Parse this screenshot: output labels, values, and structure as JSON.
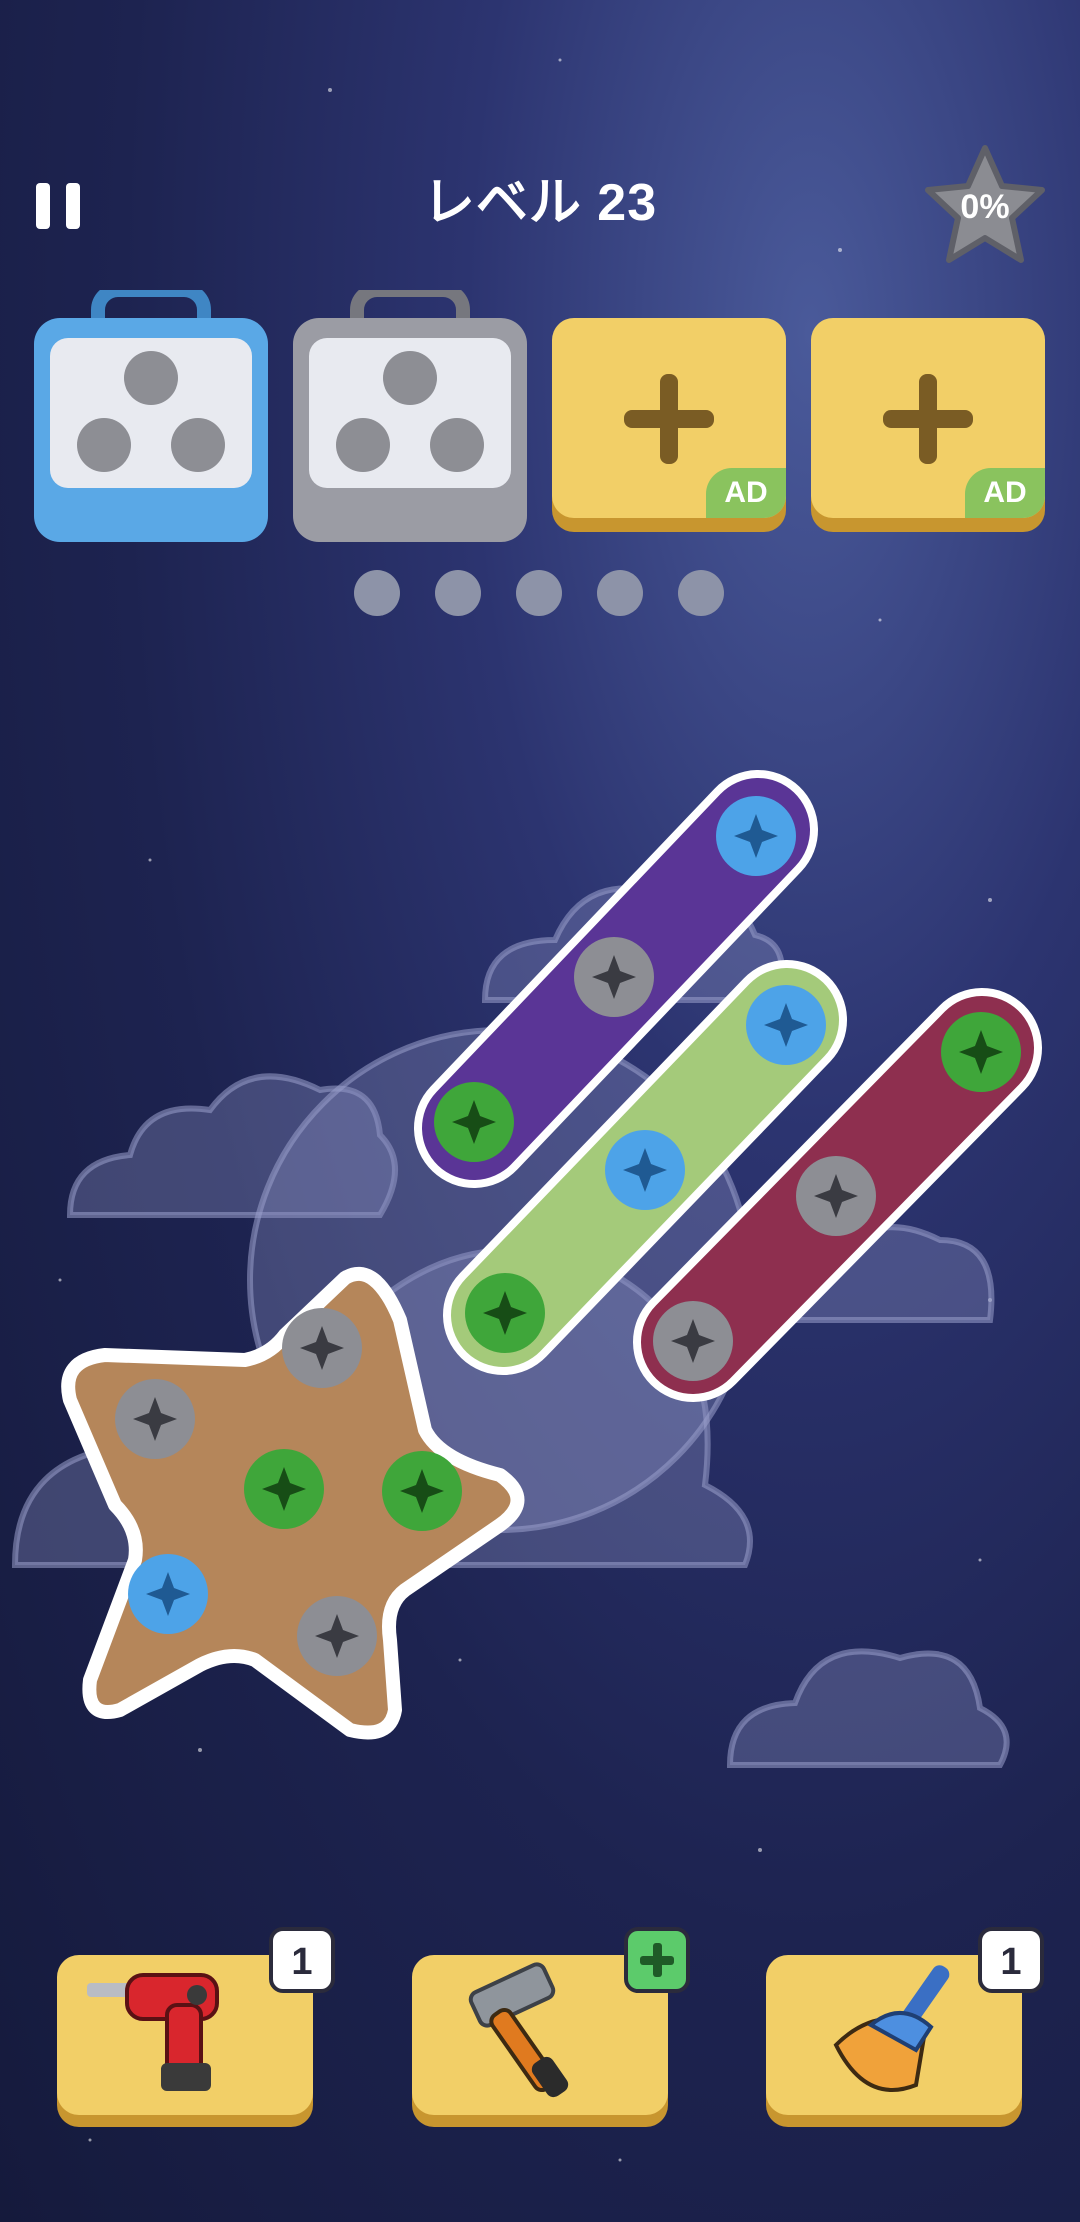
{
  "header": {
    "level_label": "レベル 23",
    "progress_label": "0%",
    "progress": 0
  },
  "boxes": [
    {
      "name": "blue-screw-box",
      "color": "#5aa8e6",
      "holes": 3
    },
    {
      "name": "gray-screw-box",
      "color": "#9b9ca4",
      "holes": 3
    }
  ],
  "ad_slots": [
    {
      "badge": "AD"
    },
    {
      "badge": "AD"
    }
  ],
  "buffer_holes": 5,
  "plates": [
    {
      "shape": "bar",
      "color": "purple",
      "screws": [
        "blue",
        "gray",
        "green"
      ]
    },
    {
      "shape": "bar",
      "color": "light-green",
      "screws": [
        "blue",
        "blue",
        "green"
      ]
    },
    {
      "shape": "bar",
      "color": "crimson",
      "screws": [
        "green",
        "gray",
        "gray"
      ]
    },
    {
      "shape": "star",
      "color": "tan",
      "screws": [
        "gray",
        "gray",
        "green",
        "green",
        "blue",
        "gray"
      ]
    }
  ],
  "colors": {
    "screw_blue": "#4da3e8",
    "screw_green": "#3fa63a",
    "screw_gray": "#8d8e94",
    "tool_bg": "#f2cf67"
  },
  "tools": [
    {
      "name": "drill",
      "count": "1",
      "icon": "drill-icon"
    },
    {
      "name": "hammer",
      "icon": "hammer-icon"
    },
    {
      "name": "broom",
      "count": "1",
      "icon": "broom-icon"
    }
  ]
}
